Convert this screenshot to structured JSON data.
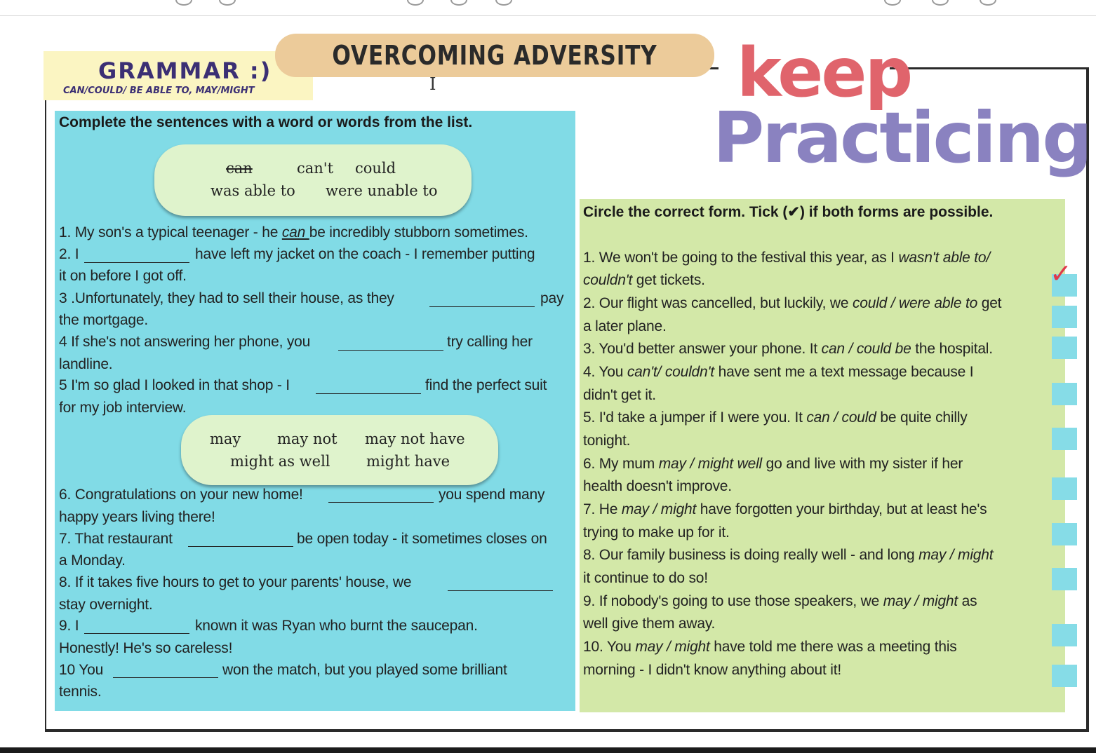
{
  "header": {
    "grammar_title": "GRAMMAR :)",
    "grammar_subtitle": "CAN/COULD/ BE ABLE TO, MAY/MIGHT",
    "topic_title": "OVERCOMING ADVERSITY",
    "keep": "keep",
    "practicing": "Practicing"
  },
  "left": {
    "instruction": "Complete the sentences with a word or words from the list.",
    "wordbox1": {
      "w1": "can",
      "w2": "can't",
      "w3": "could",
      "w4": "was able to",
      "w5": "were unable to"
    },
    "wordbox2": {
      "w1": "may",
      "w2": "may not",
      "w3": "may not have",
      "w4": "might as well",
      "w5": "might have"
    },
    "s1_pre": "1. My son's a typical teenager - he ",
    "s1_ans": "can ",
    "s1_post": "be incredibly stubborn sometimes.",
    "s2a_pre": "2. I",
    "s2a_post": "have left my jacket on the coach - I remember putting",
    "s2b": "it on before I got off.",
    "s3a_pre": "3 .Unfortunately, they had to sell their house, as they",
    "s3a_post": "pay",
    "s3b": "the mortgage.",
    "s4a_pre": "4 If she's not answering her phone, you",
    "s4a_post": "try calling her",
    "s4b": "landline.",
    "s5a_pre": "5 I'm so glad I looked in that shop - I",
    "s5a_post": "find the perfect suit",
    "s5b": "for my job interview.",
    "s6a_pre": "6. Congratulations on your new home!",
    "s6a_post": "you spend many",
    "s6b": "happy years living there!",
    "s7a_pre": "7. That restaurant",
    "s7a_post": "be open today - it sometimes closes on",
    "s7b": "a Monday.",
    "s8a_pre": "8. If it takes five hours to get to your parents' house, we",
    "s8b": "stay overnight.",
    "s9a_pre": "9. I",
    "s9a_post": "known it was Ryan who burnt the saucepan.",
    "s9b": "Honestly! He's so careless!",
    "s10a_pre": "10 You",
    "s10a_post": "won the match, but you played some brilliant",
    "s10b": "tennis."
  },
  "right": {
    "instruction": "Circle the correct form. Tick (✔) if both forms are possible.",
    "r1a_pre": "1. We won't be going to the festival this year, as I ",
    "r1a_em": "wasn't able to/",
    "r1b_em": "couldn't",
    "r1b_post": " get tickets.",
    "r2a_pre": "2. Our flight was cancelled, but luckily, we ",
    "r2a_em": "could / were able to",
    "r2a_post": " get",
    "r2b": "a later plane.",
    "r3_pre": "3. You'd better answer your phone. It ",
    "r3_em": "can / could be",
    "r3_post": " the hospital.",
    "r4a_pre": "4. You ",
    "r4a_em": "can't/ couldn't",
    "r4a_post": " have sent me a text message because I",
    "r4b": "didn't get it.",
    "r5a_pre": "5. I'd take a jumper if I were you. It ",
    "r5a_em": "can / could",
    "r5a_post": " be quite chilly",
    "r5b": "tonight.",
    "r6a_pre": "6. My mum ",
    "r6a_em": "may / might well",
    "r6a_post": " go and live with my sister if her",
    "r6b": "health doesn't improve.",
    "r7a_pre": "7. He ",
    "r7a_em": "may / might",
    "r7a_post": " have forgotten your birthday, but at least he's",
    "r7b": "trying to make up for it.",
    "r8a_pre": "8. Our family business is doing really well - and long ",
    "r8a_em": "may / might",
    "r8b": "it continue to do so!",
    "r9a_pre": "9. If nobody's going to use those speakers, we ",
    "r9a_em": "may / might",
    "r9a_post": " as",
    "r9b": "well give them away.",
    "r10a_pre": "10. You ",
    "r10a_em": "may / might",
    "r10a_post": " have told me there was a meeting this",
    "r10b": "morning - I didn't know anything about it!",
    "tick_mark": "✓"
  }
}
